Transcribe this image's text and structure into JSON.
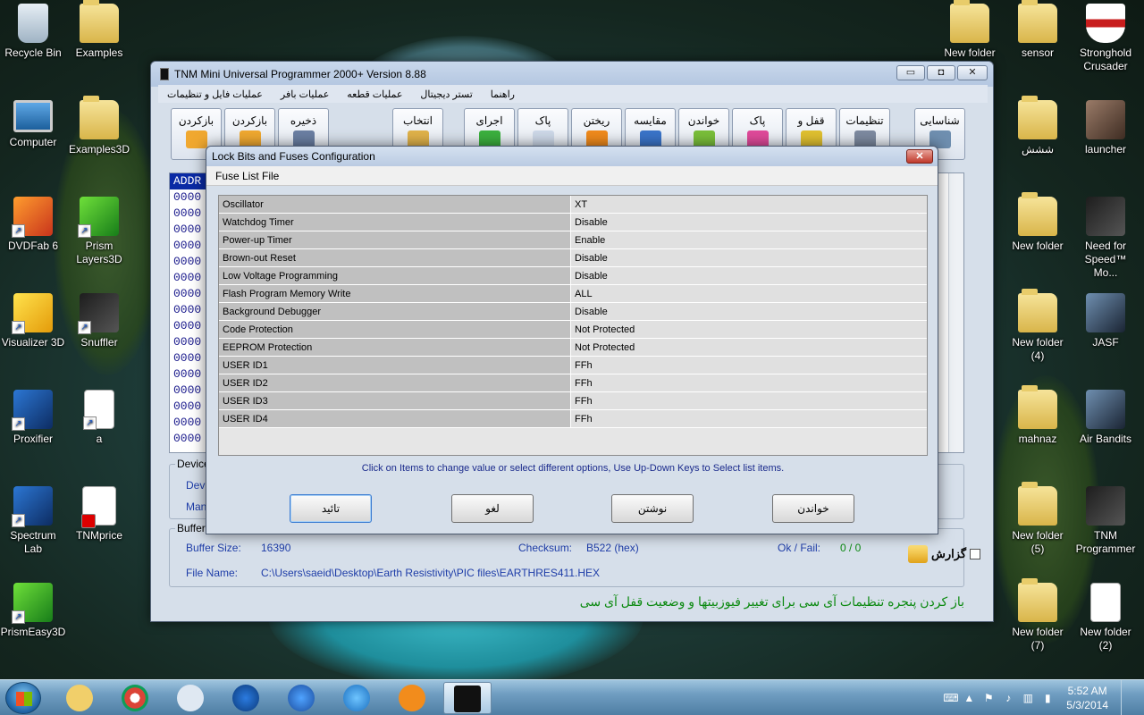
{
  "desktop": {
    "icons_left": [
      {
        "label": "Recycle Bin",
        "type": "bin"
      },
      {
        "label": "Examples",
        "type": "folder"
      },
      {
        "label": "Computer",
        "type": "pc"
      },
      {
        "label": "Examples3D",
        "type": "folder"
      },
      {
        "label": "DVDFab 6",
        "type": "app"
      },
      {
        "label": "Prism Layers3D",
        "type": "app2"
      },
      {
        "label": "Visualizer 3D",
        "type": "app3"
      },
      {
        "label": "Snuffler",
        "type": "app5"
      },
      {
        "label": "Proxifier",
        "type": "app4"
      },
      {
        "label": "a",
        "type": "doc"
      },
      {
        "label": "Spectrum Lab",
        "type": "app4"
      },
      {
        "label": "TNMprice",
        "type": "pdf"
      },
      {
        "label": "PrismEasy3D",
        "type": "app2"
      }
    ],
    "icons_right": [
      {
        "label": "New folder",
        "type": "folder"
      },
      {
        "label": "sensor",
        "type": "folder"
      },
      {
        "label": "Stronghold Crusader",
        "type": "shield"
      },
      {
        "label": "ششش",
        "type": "folder"
      },
      {
        "label": "launcher",
        "type": "photo"
      },
      {
        "label": "New folder",
        "type": "folder"
      },
      {
        "label": "Need for Speed™ Mo...",
        "type": "app5"
      },
      {
        "label": "New folder (4)",
        "type": "folder"
      },
      {
        "label": "JASF",
        "type": "plane"
      },
      {
        "label": "mahnaz",
        "type": "folder"
      },
      {
        "label": "Air Bandits",
        "type": "plane"
      },
      {
        "label": "New folder (5)",
        "type": "folder"
      },
      {
        "label": "TNM Programmer",
        "type": "app5"
      },
      {
        "label": "New folder (7)",
        "type": "folder"
      },
      {
        "label": "New folder (2)",
        "type": "doc"
      }
    ]
  },
  "main_window": {
    "title": "TNM Mini Universal Programmer 2000+   Version 8.88",
    "win_min": "▭",
    "win_max": "◘",
    "win_close": "✕",
    "menu": [
      "عملیات فایل و تنظیمات",
      "عملیات بافر",
      "عملیات قطعه",
      "تستر دیجیتال",
      "راهنما"
    ],
    "toolbar": [
      {
        "label": "بازکردن",
        "name": "open-file-button"
      },
      {
        "label": "بازکردن",
        "name": "open-button-2"
      },
      {
        "label": "ذخیره",
        "name": "save-button"
      },
      {
        "label": "انتخاب",
        "name": "select-button"
      },
      {
        "label": "اجرای",
        "name": "run-button"
      },
      {
        "label": "پاک",
        "name": "clear-buffer-button"
      },
      {
        "label": "ریختن",
        "name": "program-button"
      },
      {
        "label": "مقایسه",
        "name": "compare-button"
      },
      {
        "label": "خواندن",
        "name": "read-button"
      },
      {
        "label": "پاک",
        "name": "erase-button"
      },
      {
        "label": "قفل و",
        "name": "lock-button"
      },
      {
        "label": "تنظیمات",
        "name": "settings-button"
      },
      {
        "label": "شناسایی",
        "name": "identify-button"
      }
    ],
    "hex_header": "ADDR",
    "hex_rows": [
      "0000",
      "0000",
      "0000",
      "0000",
      "0000",
      "0000",
      "0000",
      "0000",
      "0000",
      "0000",
      "0000",
      "0000",
      "0000",
      "0000",
      "0000",
      "0000"
    ],
    "device_legend": "Device",
    "device_lbl1": "Dev",
    "device_lbl2": "Man",
    "buffer_legend": "Buffer",
    "buffer_size_label": "Buffer Size:",
    "buffer_size_value": "16390",
    "checksum_label": "Checksum:",
    "checksum_value": "B522 (hex)",
    "okfail_label": "Ok / Fail:",
    "okfail_value": "0 / 0",
    "filename_label": "File Name:",
    "filename_value": "C:\\Users\\saeid\\Desktop\\Earth Resistivity\\PIC files\\EARTHRES411.HEX",
    "report_label": "گزارش",
    "status_text": "باز کردن پنجره تنظیمات  آی سی  برای تغییر فیوزبیتها و وضعیت قفل آی سی"
  },
  "dialog": {
    "title": "Lock Bits and Fuses Configuration",
    "close_glyph": "✕",
    "menu": "Fuse List File",
    "rows": [
      {
        "name": "Oscillator",
        "value": "XT"
      },
      {
        "name": "Watchdog Timer",
        "value": "Disable"
      },
      {
        "name": "Power-up Timer",
        "value": "Enable"
      },
      {
        "name": "Brown-out Reset",
        "value": "Disable"
      },
      {
        "name": "Low Voltage Programming",
        "value": "Disable"
      },
      {
        "name": "Flash Program Memory Write",
        "value": "ALL"
      },
      {
        "name": "Background Debugger",
        "value": "Disable"
      },
      {
        "name": "Code Protection",
        "value": "Not Protected"
      },
      {
        "name": "EEPROM Protection",
        "value": "Not Protected"
      },
      {
        "name": "USER ID1",
        "value": "FFh"
      },
      {
        "name": "USER ID2",
        "value": "FFh"
      },
      {
        "name": "USER ID3",
        "value": "FFh"
      },
      {
        "name": "USER ID4",
        "value": "FFh"
      }
    ],
    "hint": "Click on Items to change value or select different options, Use Up-Down Keys to Select list items.",
    "btn_ok": "تائید",
    "btn_cancel": "لغو",
    "btn_write": "نوشتن",
    "btn_read": "خواندن"
  },
  "taskbar": {
    "time": "5:52 AM",
    "date": "5/3/2014",
    "apps": [
      "explorer",
      "chrome",
      "computer",
      "internet-explorer",
      "google-earth",
      "app",
      "link",
      "tnm"
    ]
  }
}
